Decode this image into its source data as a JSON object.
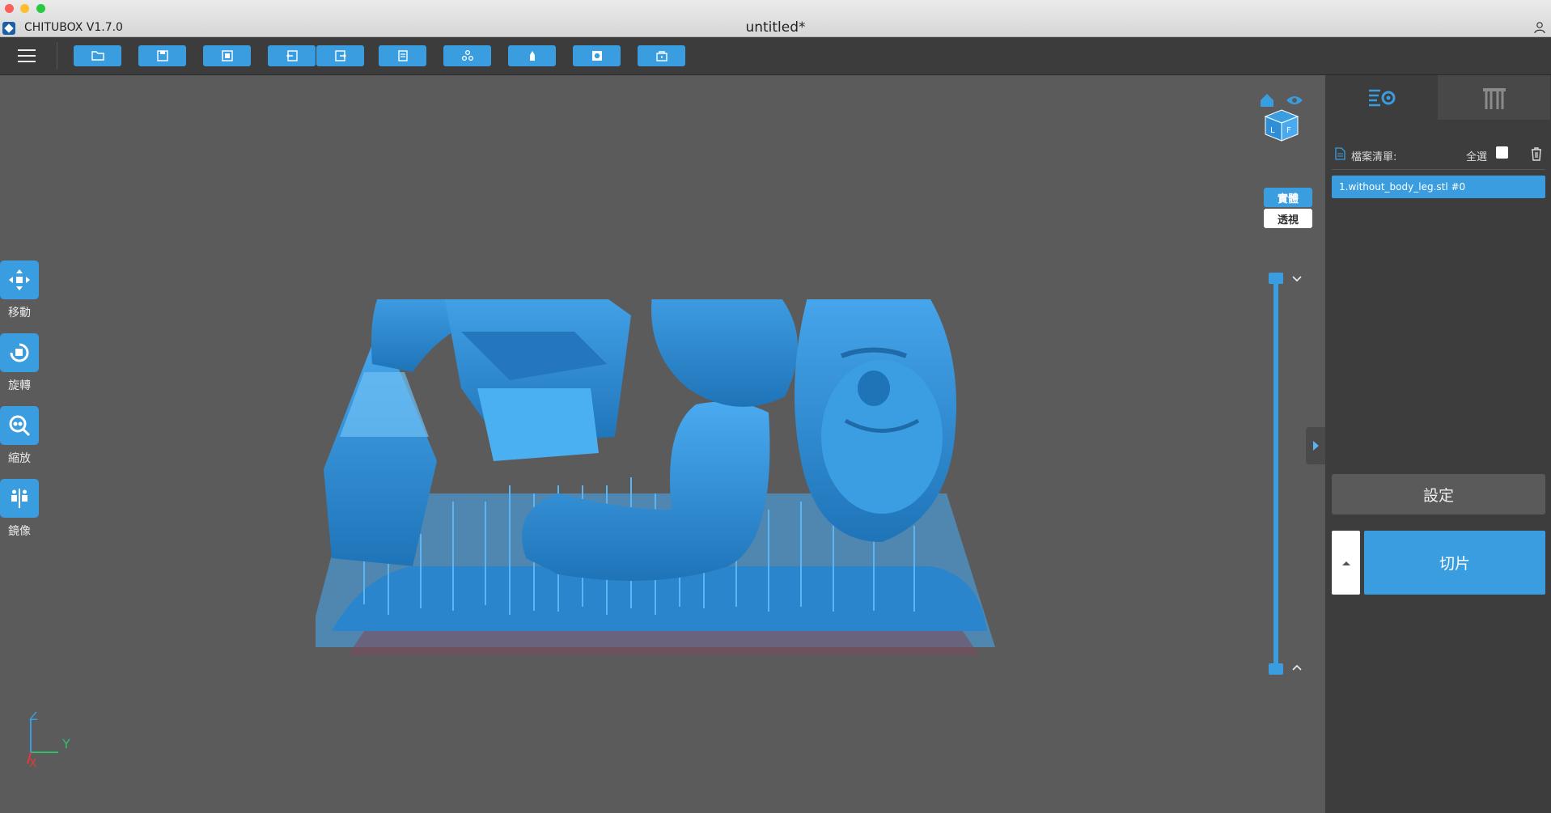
{
  "window": {
    "app_name": "CHITUBOX V1.7.0",
    "document_title": "untitled*"
  },
  "toolbar": {
    "buttons": [
      "open-file",
      "save",
      "auto-layout",
      "undo",
      "redo",
      "copy",
      "arrange",
      "support",
      "hollow",
      "drill"
    ]
  },
  "left_tools": [
    {
      "label": "移動",
      "icon": "move-icon"
    },
    {
      "label": "旋轉",
      "icon": "rotate-icon"
    },
    {
      "label": "縮放",
      "icon": "scale-icon"
    },
    {
      "label": "鏡像",
      "icon": "mirror-icon"
    }
  ],
  "view_modes": {
    "solid": "實體",
    "transparent": "透視"
  },
  "axes": {
    "z": "Z",
    "y": "Y",
    "x": "X"
  },
  "right_panel": {
    "file_list_label": "檔案清單:",
    "select_all": "全選",
    "files": [
      "1.without_body_leg.stl #0"
    ],
    "settings_button": "設定",
    "slice_button": "切片"
  },
  "colors": {
    "accent": "#3a9de0",
    "viewport": "#5b5b5b",
    "panel": "#3d3d3d",
    "model": "#2e8fd6"
  }
}
